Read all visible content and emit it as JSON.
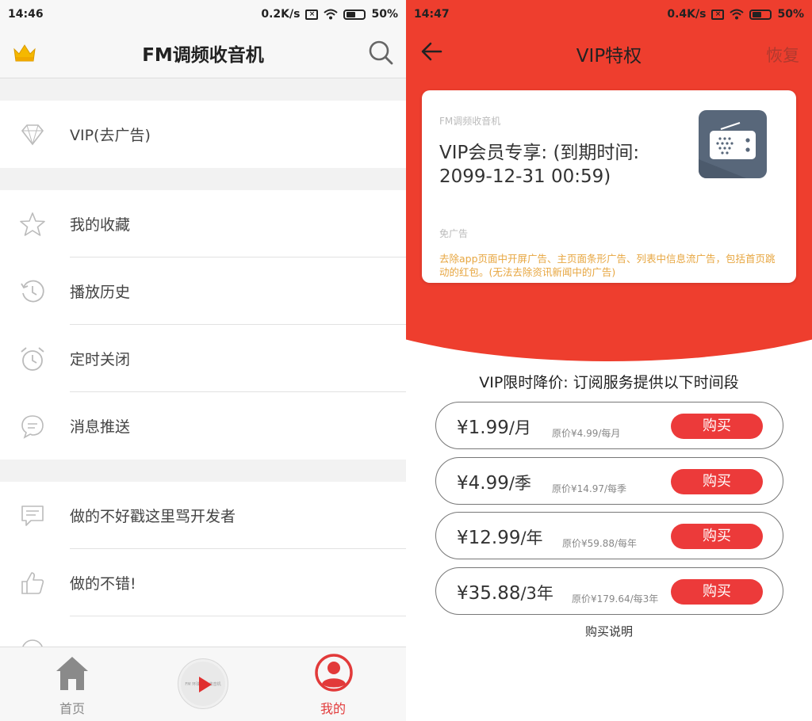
{
  "left": {
    "status": {
      "time": "14:46",
      "speed": "0.2K/s",
      "battery": "50%"
    },
    "header": {
      "title": "FM调频收音机"
    },
    "menu": {
      "vip": "VIP(去广告)",
      "favorites": "我的收藏",
      "history": "播放历史",
      "timer": "定时关闭",
      "push": "消息推送",
      "complain": "做的不好戳这里骂开发者",
      "praise": "做的不错!"
    },
    "tabs": {
      "home": "首页",
      "mine": "我的",
      "player_mini_text": "FM 环球音乐 收音机"
    }
  },
  "right": {
    "status": {
      "time": "14:47",
      "speed": "0.4K/s",
      "battery": "50%"
    },
    "header": {
      "title": "VIP特权",
      "restore": "恢复"
    },
    "card": {
      "app_name": "FM调频收音机",
      "vip_text": "VIP会员专享: (到期时间: 2099-12-31 00:59)",
      "benefit_title": "免广告",
      "benefit_desc": "去除app页面中开屏广告、主页面条形广告、列表中信息流广告，包括首页跳动的红包。(无法去除资讯新闻中的广告)"
    },
    "promo_title": "VIP限时降价: 订阅服务提供以下时间段",
    "plans": [
      {
        "price": "¥1.99",
        "unit": "/月",
        "original": "原价¥4.99/每月",
        "buy": "购买"
      },
      {
        "price": "¥4.99",
        "unit": "/季",
        "original": "原价¥14.97/每季",
        "buy": "购买"
      },
      {
        "price": "¥12.99",
        "unit": "/年",
        "original": "原价¥59.88/每年",
        "buy": "购买"
      },
      {
        "price": "¥35.88",
        "unit": "/3年",
        "original": "原价¥179.64/每3年",
        "buy": "购买"
      }
    ],
    "purchase_note": "购买说明"
  },
  "colors": {
    "accent_red": "#ee3e2e",
    "button_red": "#ec3a3a",
    "gold_text": "#e7a640",
    "crown_yellow": "#f5b800"
  }
}
